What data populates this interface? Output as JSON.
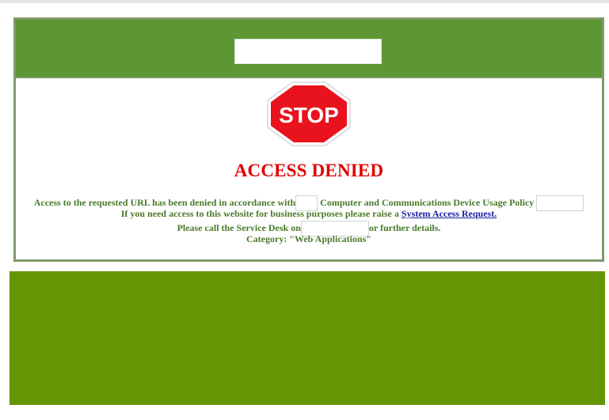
{
  "page": {
    "title": "ACCESS DENIED",
    "stop_sign_text": "STOP",
    "message": {
      "line1_before": "Access to the requested URL has been denied in accordance with",
      "line1_after": " Computer and Communications Device Usage Policy",
      "line2_before": "If you need access to this website for business purposes please raise a ",
      "line2_link": "System Access Request.",
      "line3_before": "Please call the Service Desk on",
      "line3_after": "or further details.",
      "category": "Category: \"Web Applications\""
    }
  },
  "colors": {
    "header_green": "#5d9632",
    "footer_green": "#659500",
    "denied_red": "#e00000",
    "text_green": "#4a7a2a",
    "link_blue": "#1a1aa6",
    "stop_red": "#e8131d"
  },
  "icons": {
    "stop": "stop-sign-icon"
  }
}
